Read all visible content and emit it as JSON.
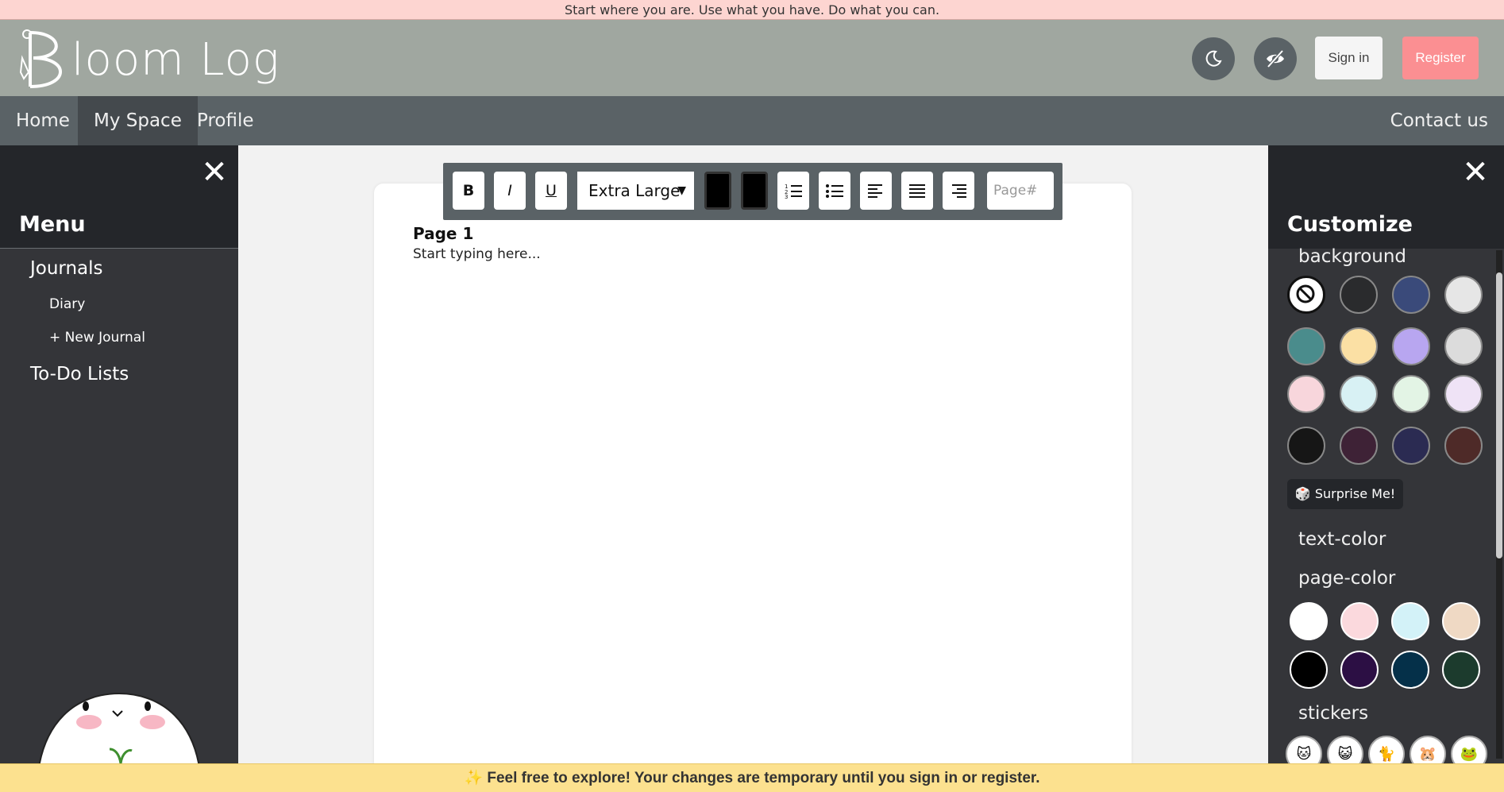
{
  "banner": {
    "quote": "Start where you are. Use what you have. Do what you can."
  },
  "header": {
    "logo_text": "loom Log",
    "signin_label": "Sign in",
    "register_label": "Register"
  },
  "nav": {
    "items": [
      "Home",
      "My Space",
      "Profile"
    ],
    "contact": "Contact us"
  },
  "menu": {
    "title": "Menu",
    "journals": "Journals",
    "diary": "Diary",
    "new_journal": "+ New Journal",
    "todo": "To-Do Lists"
  },
  "toolbar": {
    "bold": "B",
    "italic": "I",
    "underline": "U",
    "font_size": "Extra Large",
    "page_placeholder": "Page#"
  },
  "page": {
    "title": "Page 1",
    "placeholder": "Start typing here..."
  },
  "customize": {
    "title": "Customize",
    "background_label": "background",
    "surprise_label": "Surprise Me!",
    "text_color_label": "text-color",
    "page_color_label": "page-color",
    "stickers_label": "stickers",
    "background_swatches": [
      "none",
      "#2a2b2d",
      "#3a4a7a",
      "#e6e6e6",
      "#4a8c8c",
      "#fbe0a4",
      "#b8a6f0",
      "#dcdcdc",
      "#f8d6dc",
      "#d8f1f4",
      "#e3f4e5",
      "#efe3f6",
      "#161616",
      "#3e2236",
      "#2b2b52",
      "#4e2a28"
    ],
    "page_swatches": [
      "#ffffff",
      "#fbd9dd",
      "#d3f2f8",
      "#efd9c4",
      "#000000",
      "#2c0f44",
      "#053049",
      "#1c3b2d"
    ]
  },
  "footer": {
    "notice": "✨ Feel free to explore! Your changes are temporary until you sign in or register."
  }
}
